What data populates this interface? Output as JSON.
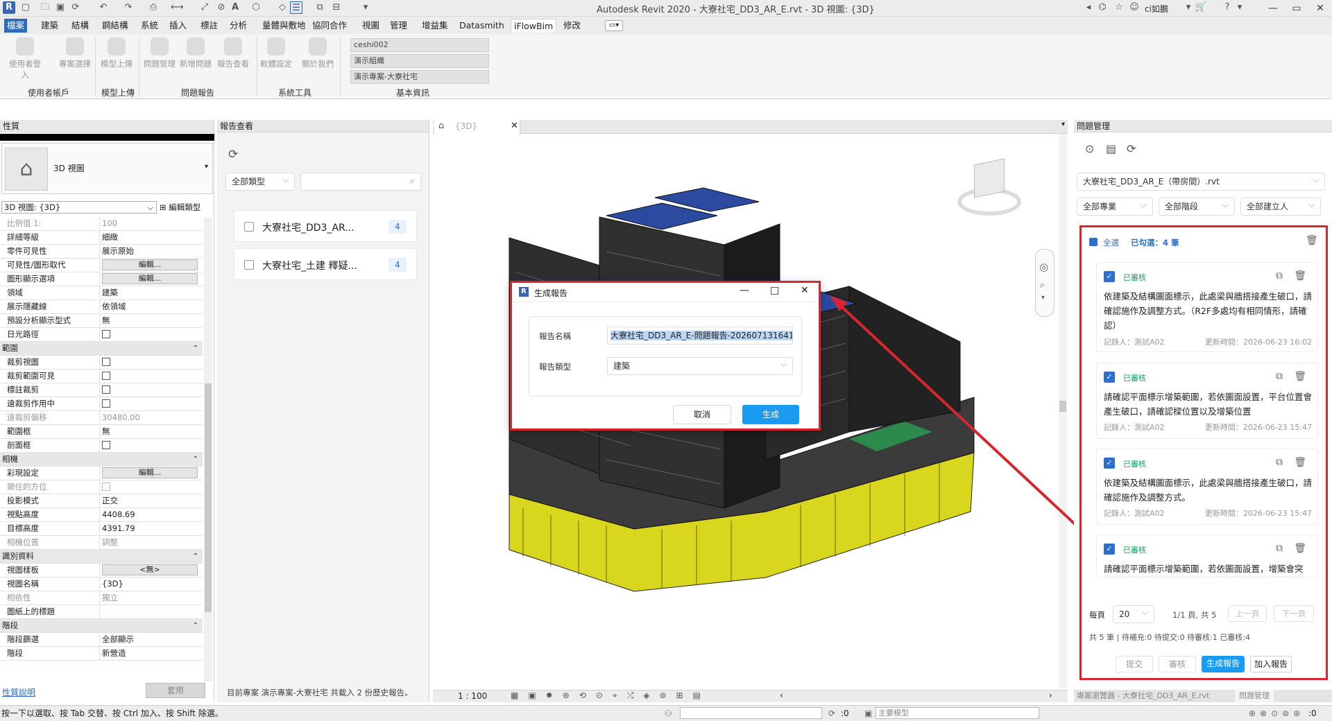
{
  "app": {
    "title": "Autodesk Revit 2020 - 大寮社宅_DD3_AR_E.rvt - 3D 視圖: {3D}",
    "user": "ci如鵬"
  },
  "menu_tabs": [
    "檔案",
    "建築",
    "結構",
    "鋼結構",
    "系統",
    "插入",
    "標註",
    "分析",
    "量體與敷地",
    "協同合作",
    "視圖",
    "管理",
    "增益集",
    "Datasmith",
    "iFlowBim",
    "修改"
  ],
  "ribbon": {
    "buttons": [
      "使用者登入",
      "專案選擇",
      "模型上傳",
      "問題管理",
      "新增問題",
      "報告查看",
      "軟體設定",
      "關於我們"
    ],
    "fields": [
      "ceshi002",
      "演示組織",
      "演示專案-大寮社宅"
    ],
    "groups": [
      "使用者帳戶",
      "模型上傳",
      "問題報告",
      "系統工具",
      "基本資訊"
    ]
  },
  "properties": {
    "header": "性質",
    "type_name": "3D 視圖",
    "view_selector": "3D 視圖: {3D}",
    "edit_type": "編輯類型",
    "rows": [
      {
        "k": "比例值 1:",
        "v": "100",
        "dis": true
      },
      {
        "k": "詳細等級",
        "v": "細緻"
      },
      {
        "k": "零件可見性",
        "v": "展示原始"
      },
      {
        "k": "可見性/圖形取代",
        "btn": "編輯..."
      },
      {
        "k": "圖形顯示選項",
        "btn": "編輯..."
      },
      {
        "k": "領域",
        "v": "建築"
      },
      {
        "k": "展示隱藏線",
        "v": "依領域"
      },
      {
        "k": "預設分析顯示型式",
        "v": "無"
      },
      {
        "k": "日光路徑",
        "cb": true
      },
      {
        "sec": "範圍"
      },
      {
        "k": "裁剪視圖",
        "cb": true
      },
      {
        "k": "裁剪範圍可見",
        "cb": true
      },
      {
        "k": "標註裁剪",
        "cb": true
      },
      {
        "k": "遠裁剪作用中",
        "cb": true
      },
      {
        "k": "遠裁剪偏移",
        "v": "30480.00",
        "dis": true
      },
      {
        "k": "範圍框",
        "v": "無"
      },
      {
        "k": "剖面框",
        "cb": true
      },
      {
        "sec": "相機"
      },
      {
        "k": "彩現設定",
        "btn": "編輯..."
      },
      {
        "k": "鎖住的方位",
        "cb": true,
        "dis": true
      },
      {
        "k": "投影模式",
        "v": "正交"
      },
      {
        "k": "視點高度",
        "v": "4408.69"
      },
      {
        "k": "目標高度",
        "v": "4391.79"
      },
      {
        "k": "相機位置",
        "v": "調整",
        "dis": true
      },
      {
        "sec": "識別資料"
      },
      {
        "k": "視圖樣板",
        "btn": "<無>"
      },
      {
        "k": "視圖名稱",
        "v": "{3D}"
      },
      {
        "k": "相依性",
        "v": "獨立",
        "dis": true
      },
      {
        "k": "圖紙上的標題",
        "v": ""
      },
      {
        "sec": "階段"
      },
      {
        "k": "階段篩選",
        "v": "全部顯示"
      },
      {
        "k": "階段",
        "v": "新營造"
      }
    ],
    "help_link": "性質說明",
    "apply": "套用"
  },
  "reports": {
    "header": "報告查看",
    "filter": "全部類型",
    "items": [
      {
        "title": "大寮社宅_DD3_AR...",
        "count": "4"
      },
      {
        "title": "大寮社宅_土建 釋疑...",
        "count": "4"
      }
    ],
    "footer": "目前專案 演示專案-大寮社宅 共載入 2 份歷史報告。"
  },
  "view": {
    "tab": "{3D}",
    "scale": "1 : 100"
  },
  "dialog": {
    "title": "生成報告",
    "name_label": "報告名稱",
    "name_value": "大寮社宅_DD3_AR_E-問題報告-202607131641",
    "type_label": "報告類型",
    "type_value": "建築",
    "cancel": "取消",
    "generate": "生成"
  },
  "issues": {
    "header": "問題管理",
    "file": "大寮社宅_DD3_AR_E（帶房間）.rvt",
    "filters": [
      "全部專業",
      "全部階段",
      "全部建立人"
    ],
    "select_all": "全選",
    "selected": "已勾選：4 筆",
    "cards": [
      {
        "status": "已審核",
        "text": "依建築及結構圖面標示，此處梁與牆搭接產生破口，請確認施作及調整方式。（R2F多處均有相同情形，請確認）",
        "recorder": "記錄人：測試A02",
        "time": "更新時間：2026-06-23 16:02"
      },
      {
        "status": "已審核",
        "text": "請確認平面標示增築範圍，若依圖面設置，平台位置會產生破口，請確認樑位置以及增築位置",
        "recorder": "記錄人：測試A02",
        "time": "更新時間：2026-06-23 15:47"
      },
      {
        "status": "已審核",
        "text": "依建築及結構圖面標示，此處梁與牆搭接產生破口，請確認施作及調整方式。",
        "recorder": "記錄人：測試A02",
        "time": "更新時間：2026-06-23 15:47"
      },
      {
        "status": "已審核",
        "text": "請確認平面標示增築範圍，若依圖面設置，增築會突",
        "recorder": "",
        "time": ""
      }
    ],
    "per_page_label": "每頁",
    "per_page": "20",
    "page_info": "1/1 頁, 共 5",
    "prev": "上一頁",
    "next": "下一頁",
    "summary": "共 5 筆 | 待補充:0 待提交:0 待審核:1 已審核:4",
    "buttons": [
      "提交",
      "審核",
      "生成報告",
      "加入報告"
    ],
    "bottom_tabs": [
      "專案瀏覽器 - 大寮社宅_DD3_AR_E.rvt",
      "問題管理"
    ]
  },
  "status": {
    "hint": "按一下以選取、按 Tab 交替、按 Ctrl 加入、按 Shift 除選。",
    "zero1": ":0",
    "model": "主要模型",
    "zero2": ":0"
  },
  "colors": {
    "accent": "#2c6fce",
    "highlight": "#d7262e",
    "approved": "#19a05c"
  }
}
